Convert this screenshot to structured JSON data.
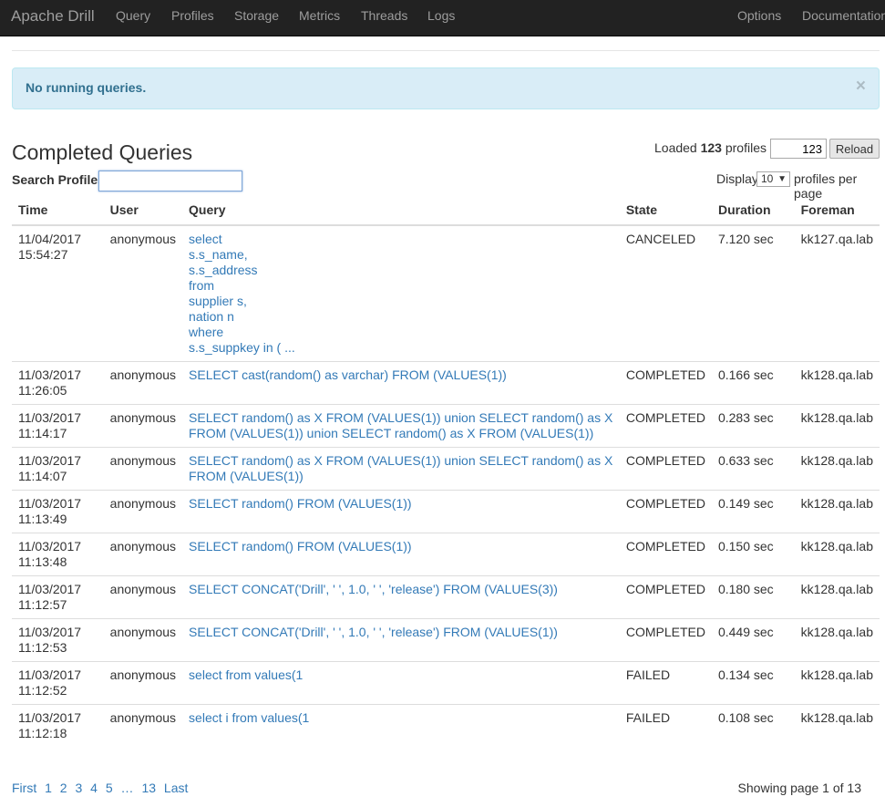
{
  "nav": {
    "brand": "Apache Drill",
    "items": [
      "Query",
      "Profiles",
      "Storage",
      "Metrics",
      "Threads",
      "Logs"
    ],
    "right_items": [
      "Options",
      "Documentation"
    ]
  },
  "alert": {
    "text": "No running queries.",
    "close": "×"
  },
  "completed": {
    "title": "Completed Queries",
    "search_label": "Search Profiles",
    "search_value": "",
    "loaded_prefix": "Loaded ",
    "loaded_count": "123",
    "loaded_suffix": " profiles",
    "count_input_value": "123",
    "reload_label": "Reload",
    "display_label": "Display",
    "display_value": "10",
    "display_suffix": "profiles per page"
  },
  "table": {
    "headers": [
      "Time",
      "User",
      "Query",
      "State",
      "Duration",
      "Foreman"
    ],
    "rows": [
      {
        "date": "11/04/2017",
        "time": "15:54:27",
        "user": "anonymous",
        "query": [
          "select",
          "s.s_name,",
          "s.s_address",
          "from",
          "supplier s,",
          "nation n",
          "where",
          "s.s_suppkey in ( ..."
        ],
        "state": "CANCELED",
        "duration": "7.120 sec",
        "foreman": "kk127.qa.lab"
      },
      {
        "date": "11/03/2017",
        "time": "11:26:05",
        "user": "anonymous",
        "query": [
          "SELECT cast(random() as varchar) FROM (VALUES(1))"
        ],
        "state": "COMPLETED",
        "duration": "0.166 sec",
        "foreman": "kk128.qa.lab"
      },
      {
        "date": "11/03/2017",
        "time": "11:14:17",
        "user": "anonymous",
        "query": [
          "SELECT random() as X FROM (VALUES(1)) union SELECT random() as X FROM (VALUES(1)) union SELECT random() as X FROM (VALUES(1))"
        ],
        "state": "COMPLETED",
        "duration": "0.283 sec",
        "foreman": "kk128.qa.lab"
      },
      {
        "date": "11/03/2017",
        "time": "11:14:07",
        "user": "anonymous",
        "query": [
          "SELECT random() as X FROM (VALUES(1)) union SELECT random() as X FROM (VALUES(1))"
        ],
        "state": "COMPLETED",
        "duration": "0.633 sec",
        "foreman": "kk128.qa.lab"
      },
      {
        "date": "11/03/2017",
        "time": "11:13:49",
        "user": "anonymous",
        "query": [
          "SELECT random() FROM (VALUES(1))"
        ],
        "state": "COMPLETED",
        "duration": "0.149 sec",
        "foreman": "kk128.qa.lab"
      },
      {
        "date": "11/03/2017",
        "time": "11:13:48",
        "user": "anonymous",
        "query": [
          "SELECT random() FROM (VALUES(1))"
        ],
        "state": "COMPLETED",
        "duration": "0.150 sec",
        "foreman": "kk128.qa.lab"
      },
      {
        "date": "11/03/2017",
        "time": "11:12:57",
        "user": "anonymous",
        "query": [
          "SELECT CONCAT('Drill', ' ', 1.0, ' ', 'release') FROM (VALUES(3))"
        ],
        "state": "COMPLETED",
        "duration": "0.180 sec",
        "foreman": "kk128.qa.lab"
      },
      {
        "date": "11/03/2017",
        "time": "11:12:53",
        "user": "anonymous",
        "query": [
          "SELECT CONCAT('Drill', ' ', 1.0, ' ', 'release') FROM (VALUES(1))"
        ],
        "state": "COMPLETED",
        "duration": "0.449 sec",
        "foreman": "kk128.qa.lab"
      },
      {
        "date": "11/03/2017",
        "time": "11:12:52",
        "user": "anonymous",
        "query": [
          "select from values(1"
        ],
        "state": "FAILED",
        "duration": "0.134 sec",
        "foreman": "kk128.qa.lab"
      },
      {
        "date": "11/03/2017",
        "time": "11:12:18",
        "user": "anonymous",
        "query": [
          "select i from values(1"
        ],
        "state": "FAILED",
        "duration": "0.108 sec",
        "foreman": "kk128.qa.lab"
      }
    ]
  },
  "pagination": {
    "first": "First",
    "pages": [
      "1",
      "2",
      "3",
      "4",
      "5"
    ],
    "ellipsis": "…",
    "last_page": "13",
    "last": "Last",
    "info": "Showing page 1 of 13"
  },
  "colors": {
    "navbar_bg": "#222222",
    "nav_text": "#9d9d9d",
    "link": "#337ab7",
    "alert_bg": "#d9edf7",
    "alert_text": "#31708f"
  }
}
